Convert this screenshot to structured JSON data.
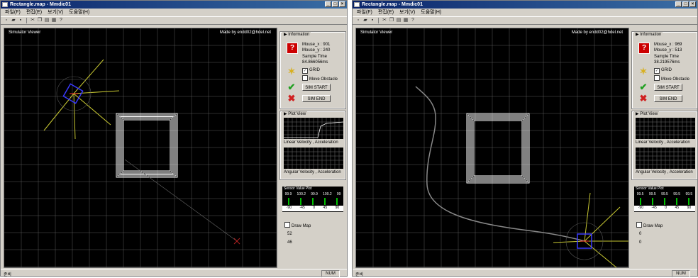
{
  "windows": [
    {
      "title": "Rectangle.map - Mmdic01",
      "menu": [
        "파일(F)",
        "편집(E)",
        "보기(V)",
        "도움말(H)"
      ],
      "toolbar_icons": [
        "new-file-icon",
        "open-folder-icon",
        "save-icon",
        "cut-icon",
        "copy-icon",
        "paste-icon",
        "print-icon",
        "help-icon"
      ],
      "simulator": {
        "title": "Simulator Viewer",
        "credit": "Made by endd02@hdel.net"
      },
      "information": {
        "title": "Information",
        "mouse_x_label": "Mouse_x",
        "mouse_x_value": ": 901",
        "mouse_y_label": "Mouse_y",
        "mouse_y_value": ": 240",
        "sample_label": "Sample Time",
        "sample_value": "84.866056ms",
        "grid_label": "GRID",
        "grid_checked": true,
        "move_obstacle_label": "Move Obstacle",
        "move_obstacle_checked": false,
        "sim_start": "SIM START",
        "sim_end": "SIM END"
      },
      "plot_view": {
        "title": "Plot View",
        "linear_label": "Linear Velocity , Acceleration",
        "angular_label": "Angular Velocity , Acceleration"
      },
      "sensor": {
        "title": "Sensor Value Plot",
        "values": [
          "99.9",
          "100.2",
          "99.9",
          "100.2",
          "99"
        ],
        "angles": [
          "-90",
          "-45",
          "0",
          "45",
          "90"
        ]
      },
      "draw_map": {
        "label": "Draw Map",
        "checked": false,
        "value1": "52",
        "value2": "46"
      },
      "status": {
        "left": "준비",
        "num": "NUM"
      }
    },
    {
      "title": "Rectangle.map - Mmdic01",
      "menu": [
        "파일(F)",
        "편집(E)",
        "보기(V)",
        "도움말(H)"
      ],
      "toolbar_icons": [
        "new-file-icon",
        "open-folder-icon",
        "save-icon",
        "cut-icon",
        "copy-icon",
        "paste-icon",
        "print-icon",
        "help-icon"
      ],
      "simulator": {
        "title": "Simulator Viewer",
        "credit": "Made by endd02@hdel.net"
      },
      "information": {
        "title": "Information",
        "mouse_x_label": "Mouse_x",
        "mouse_x_value": ": 969",
        "mouse_y_label": "Mouse_y",
        "mouse_y_value": ": 513",
        "sample_label": "Sample Time",
        "sample_value": "38.219576ms",
        "grid_label": "GRID",
        "grid_checked": true,
        "move_obstacle_label": "Move Obstacle",
        "move_obstacle_checked": false,
        "sim_start": "SIM START",
        "sim_end": "SIM END"
      },
      "plot_view": {
        "title": "Plot View",
        "linear_label": "Linear Velocity , Acceleration",
        "angular_label": "Angular Velocity , Acceleration"
      },
      "sensor": {
        "title": "Sensor Value Plot",
        "values": [
          "99.5",
          "99.5",
          "99.5",
          "99.5",
          "99.5"
        ],
        "angles": [
          "-90",
          "-45",
          "0",
          "45",
          "90"
        ]
      },
      "draw_map": {
        "label": "Draw Map",
        "checked": false,
        "value1": "0",
        "value2": "0"
      },
      "status": {
        "left": "준비",
        "num": "NUM"
      }
    }
  ],
  "colors": {
    "title_bar": "#0a246a",
    "grid": "#5a5a5a",
    "trail": "#ffffff",
    "sensor_ray": "#c8c832",
    "robot": "#3a3aff",
    "sensor_bar": "#00c000"
  }
}
